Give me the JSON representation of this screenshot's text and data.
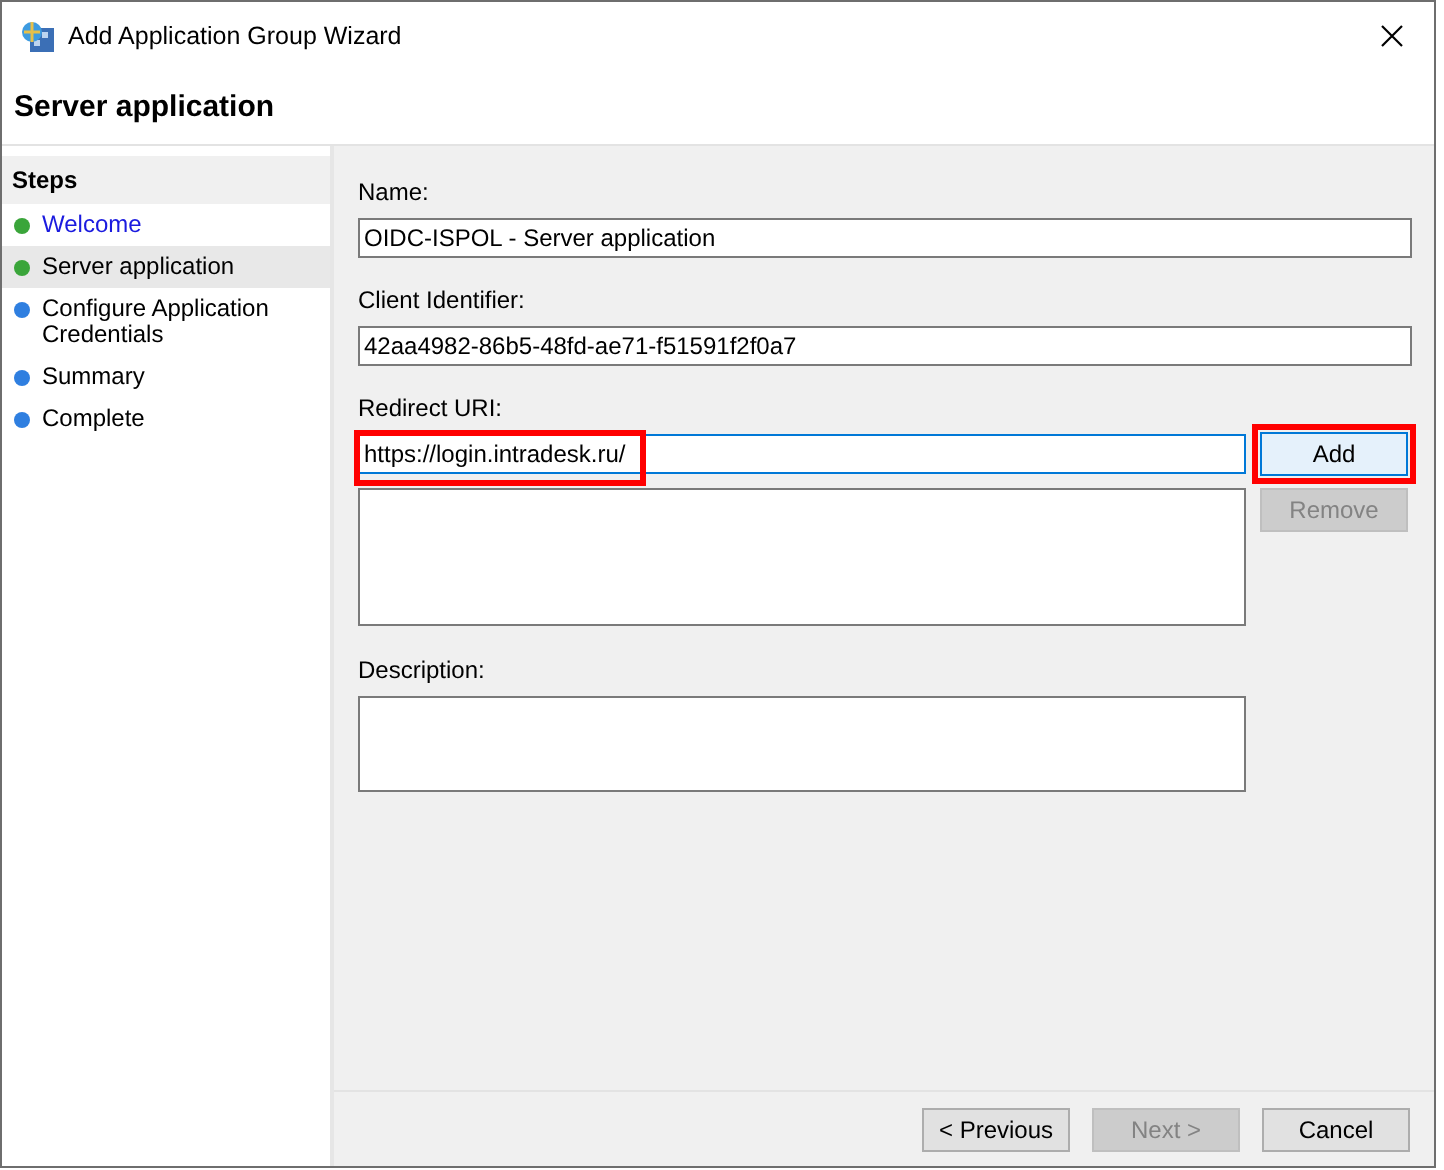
{
  "window": {
    "title": "Add Application Group Wizard"
  },
  "page_title": "Server application",
  "steps": {
    "heading": "Steps",
    "items": [
      {
        "label": "Welcome",
        "kind": "link",
        "color": "#3aa53a",
        "selected": false
      },
      {
        "label": "Server application",
        "kind": "text",
        "color": "#3aa53a",
        "selected": true
      },
      {
        "label": "Configure Application Credentials",
        "kind": "text",
        "color": "#2f7fe0",
        "selected": false
      },
      {
        "label": "Summary",
        "kind": "text",
        "color": "#2f7fe0",
        "selected": false
      },
      {
        "label": "Complete",
        "kind": "text",
        "color": "#2f7fe0",
        "selected": false
      }
    ]
  },
  "form": {
    "name": {
      "label": "Name:",
      "value": "OIDC-ISPOL - Server application"
    },
    "client_identifier": {
      "label": "Client Identifier:",
      "value": "42aa4982-86b5-48fd-ae71-f51591f2f0a7"
    },
    "redirect_uri": {
      "label": "Redirect URI:",
      "value": "https://login.intradesk.ru/",
      "highlighted": true,
      "add_button": {
        "label": "Add",
        "highlighted": true,
        "disabled": false
      },
      "remove_button": {
        "label": "Remove",
        "disabled": true
      }
    },
    "description": {
      "label": "Description:"
    }
  },
  "buttons": [
    {
      "label": "< Previous",
      "disabled": false
    },
    {
      "label": "Next >",
      "disabled": true
    },
    {
      "label": "Cancel",
      "disabled": false
    }
  ]
}
